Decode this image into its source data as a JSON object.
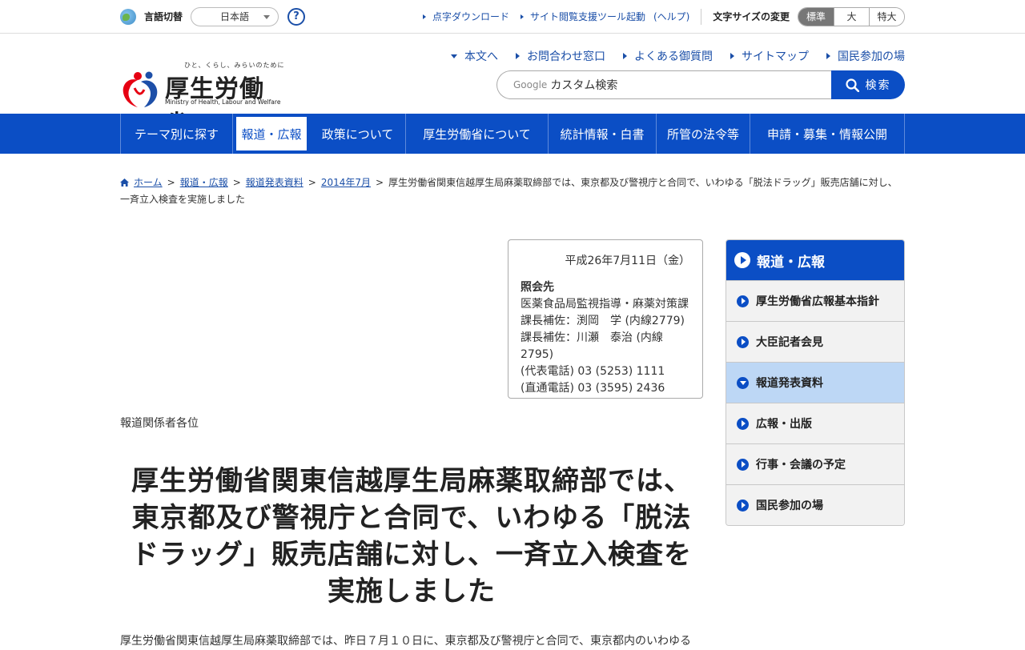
{
  "utility": {
    "lang_label": "言語切替",
    "lang_value": "日本語",
    "help_label": "?",
    "links": [
      "点字ダウンロード",
      "サイト閲覧支援ツール起動"
    ],
    "help_link": "(ヘルプ)",
    "fontsize_label": "文字サイズの変更",
    "fontsize_options": [
      "標準",
      "大",
      "特大"
    ],
    "fontsize_selected": "標準"
  },
  "header": {
    "logo_tagline": "ひと、くらし、みらいのために",
    "logo_title": "厚生労働省",
    "logo_english": "Ministry of Health, Labour and Welfare",
    "nav": [
      "本文へ",
      "お問合わせ窓口",
      "よくある御質問",
      "サイトマップ",
      "国民参加の場"
    ],
    "search_placeholder": "カスタム検索",
    "search_brand": "Google",
    "search_button": "検索"
  },
  "global_nav": [
    "テーマ別に探す",
    "報道・広報",
    "政策について",
    "厚生労働省について",
    "統計情報・白書",
    "所管の法令等",
    "申請・募集・情報公開"
  ],
  "global_nav_active": "報道・広報",
  "breadcrumb": {
    "links": [
      "ホーム",
      "報道・広報",
      "報道発表資料",
      "2014年7月"
    ],
    "current": "厚生労働省関東信越厚生局麻薬取締部では、東京都及び警視庁と合同で、いわゆる「脱法ドラッグ」販売店舗に対し、一斉立入検査を実施しました"
  },
  "contact": {
    "date": "平成26年7月11日（金）",
    "heading": "照会先",
    "lines": [
      "医薬食品局監視指導・麻薬対策課",
      "課長補佐：渕岡　学 (内線2779)",
      "課長補佐：川瀬　泰治 (内線2795)",
      "(代表電話) 03 (5253) 1111",
      "(直通電話) 03 (3595) 2436"
    ]
  },
  "addressee": "報道関係者各位",
  "title_lines": [
    "厚生労働省関東信越厚生局麻薬取締部では、",
    "東京都及び警視庁と合同で、いわゆる「脱法",
    "ドラッグ」販売店舗に対し、一斉立入検査を",
    "実施しました"
  ],
  "body_text": "厚生労働省関東信越厚生局麻薬取締部では、昨日７月１０日に、東京都及び警視庁と合同で、東京都内のいわゆる",
  "side_nav": {
    "heading": "報道・広報",
    "items": [
      "厚生労働省広報基本指針",
      "大臣記者会見",
      "報道発表資料",
      "広報・出版",
      "行事・会議の予定",
      "国民参加の場"
    ],
    "active": "報道発表資料"
  },
  "colors": {
    "brand_blue": "#0b4ec5",
    "side_active": "#bdd7f5",
    "link": "#1b4fa8"
  }
}
